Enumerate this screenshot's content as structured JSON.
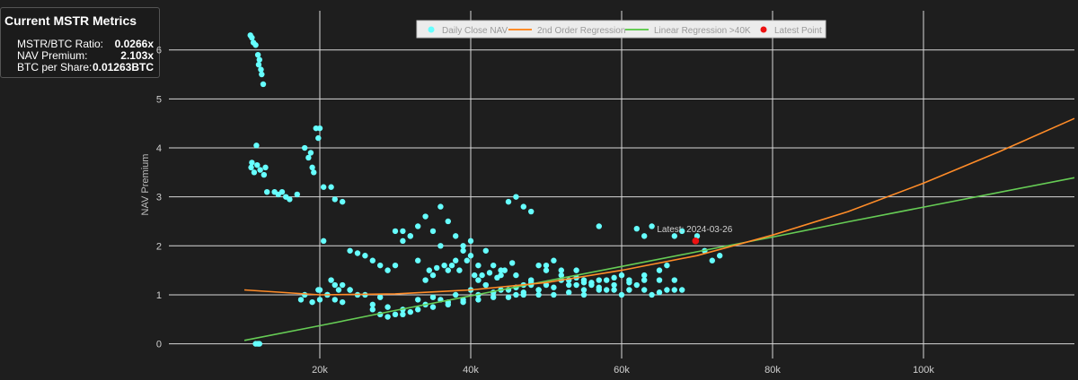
{
  "metrics": {
    "title": "Current MSTR Metrics",
    "rows": [
      {
        "label": "MSTR/BTC Ratio:",
        "value": "0.0266x"
      },
      {
        "label": "NAV Premium:",
        "value": "2.103x"
      },
      {
        "label": "BTC per Share:",
        "value": "0.01263BTC"
      }
    ]
  },
  "chart_data": {
    "type": "scatter",
    "ylabel": "NAV Premium",
    "xlim": [
      0,
      120000
    ],
    "ylim": [
      -0.3,
      6.8
    ],
    "x_ticks": [
      20000,
      40000,
      60000,
      80000,
      100000
    ],
    "x_tick_labels": [
      "20k",
      "40k",
      "60k",
      "80k",
      "100k"
    ],
    "y_ticks": [
      0,
      1,
      2,
      3,
      4,
      5,
      6
    ],
    "y_tick_labels": [
      "0",
      "1",
      "2",
      "3",
      "4",
      "5",
      "6"
    ],
    "grid": true,
    "legend_position": "top-center",
    "latest_annotation": "Latest: 2024-03-26",
    "colors": {
      "points": "#66ffff",
      "quad": "#ff8c28",
      "linear": "#66cc55",
      "latest": "#ee1111",
      "grid": "#d8d8d8"
    },
    "series": [
      {
        "name": "Daily Close NAV",
        "kind": "markers",
        "x": [
          10800,
          11000,
          11200,
          11500,
          11800,
          12000,
          11900,
          12300,
          12500,
          12200,
          11000,
          10900,
          11300,
          11700,
          12100,
          11600,
          12800,
          12600,
          13000,
          14000,
          14500,
          15000,
          15500,
          16000,
          17000,
          18000,
          18500,
          19000,
          19500,
          20000,
          19800,
          18800,
          19200,
          20500,
          21500,
          22000,
          23000,
          24000,
          25000,
          26000,
          27000,
          28000,
          29000,
          30000,
          31000,
          32000,
          33000,
          34000,
          35000,
          36000,
          37000,
          38000,
          39000,
          40000,
          41000,
          42000,
          43000,
          44000,
          45000,
          46000,
          47000,
          48000,
          49000,
          50000,
          51000,
          52000,
          53000,
          54000,
          55000,
          56000,
          57000,
          58000,
          59000,
          60000,
          61000,
          62000,
          63000,
          64000,
          65000,
          66000,
          67000,
          68000,
          17500,
          19000,
          20000,
          21000,
          22000,
          23000,
          25000,
          27000,
          29000,
          31000,
          33000,
          35000,
          37000,
          39000,
          41000,
          43000,
          45000,
          47000,
          49000,
          51000,
          53000,
          55000,
          57000,
          59000,
          61000,
          63000,
          65000,
          67000,
          18000,
          20000,
          22000,
          24000,
          26000,
          28000,
          30000,
          32000,
          34000,
          36000,
          38000,
          40000,
          42000,
          44000,
          46000,
          48000,
          50000,
          52000,
          54000,
          56000,
          58000,
          60000,
          36000,
          38000,
          39000,
          40000,
          37000,
          35000,
          34000,
          33000,
          41000,
          42000,
          44000,
          46000,
          48000,
          50000,
          52000,
          54000,
          30000,
          31000,
          32000,
          20500,
          21500,
          23000,
          24000,
          46000,
          47000,
          48000,
          49000,
          55000,
          57000,
          62000,
          63000,
          64000,
          66000,
          67000,
          68000,
          70000,
          71000,
          72000,
          73000,
          11500,
          11800,
          12000,
          19800,
          21000,
          22500,
          27000,
          28000,
          29000,
          31000,
          33000,
          35000,
          37000,
          39000,
          41000,
          43000,
          45000,
          47000,
          49000,
          51000,
          53000,
          55000,
          57000,
          59000,
          61000,
          63000,
          65000,
          36500,
          37500,
          38500,
          39500,
          40500,
          34500,
          35500,
          45500,
          43500,
          42500,
          41500,
          44500
        ],
        "y": [
          6.3,
          6.25,
          6.15,
          6.1,
          5.9,
          5.8,
          5.7,
          5.5,
          5.3,
          5.6,
          3.7,
          3.6,
          3.5,
          3.65,
          3.55,
          4.05,
          3.6,
          3.45,
          3.1,
          3.1,
          3.05,
          3.1,
          3.0,
          2.95,
          3.05,
          4.0,
          3.8,
          3.6,
          4.4,
          4.4,
          4.2,
          3.9,
          3.5,
          3.2,
          3.2,
          2.95,
          2.9,
          1.9,
          1.85,
          1.8,
          1.7,
          1.6,
          1.5,
          2.3,
          2.1,
          2.2,
          2.4,
          2.6,
          2.3,
          2.8,
          2.5,
          2.2,
          2.0,
          1.8,
          1.6,
          1.9,
          1.6,
          1.4,
          2.9,
          3.0,
          2.8,
          2.7,
          1.6,
          1.5,
          1.7,
          1.5,
          1.3,
          1.2,
          1.3,
          1.2,
          1.1,
          1.1,
          1.1,
          1.0,
          1.1,
          1.2,
          1.1,
          1.0,
          1.05,
          1.1,
          1.1,
          1.1,
          0.9,
          0.85,
          0.9,
          1.0,
          0.9,
          0.85,
          1.0,
          0.8,
          0.75,
          0.7,
          0.7,
          0.75,
          0.8,
          0.85,
          0.9,
          0.95,
          0.95,
          1.0,
          1.0,
          1.0,
          1.05,
          1.1,
          1.15,
          1.2,
          1.25,
          1.3,
          1.3,
          1.3,
          1.0,
          1.1,
          1.2,
          1.1,
          1.0,
          0.95,
          0.6,
          0.65,
          0.8,
          0.9,
          1.0,
          1.1,
          1.2,
          1.1,
          1.15,
          1.2,
          1.2,
          1.3,
          1.35,
          1.25,
          1.3,
          1.4,
          2.0,
          1.7,
          1.9,
          2.1,
          1.5,
          1.4,
          1.3,
          1.7,
          1.3,
          1.2,
          1.5,
          1.4,
          1.3,
          1.6,
          1.4,
          1.5,
          1.6,
          2.3,
          2.2,
          2.1,
          1.3,
          1.2,
          1.1,
          1.0,
          1.2,
          1.25,
          1.1,
          1.0,
          2.4,
          2.35,
          2.2,
          2.4,
          1.6,
          2.2,
          2.3,
          2.2,
          1.9,
          1.7,
          1.8,
          0.0,
          0.0,
          0.0,
          1.1,
          1.0,
          1.1,
          0.7,
          0.6,
          0.55,
          0.6,
          0.9,
          0.95,
          0.85,
          0.9,
          1.0,
          1.05,
          1.1,
          1.05,
          1.1,
          1.15,
          1.2,
          1.25,
          1.3,
          1.35,
          1.3,
          1.4,
          1.5,
          1.6,
          1.6,
          1.5,
          1.7,
          1.4,
          1.5,
          1.55,
          1.65,
          1.35,
          1.45,
          1.4,
          1.5
        ]
      },
      {
        "name": "2nd Order Regression",
        "kind": "line",
        "x": [
          10000,
          20000,
          30000,
          40000,
          50000,
          60000,
          70000,
          80000,
          90000,
          100000,
          110000,
          120000
        ],
        "y": [
          1.1,
          1.0,
          1.02,
          1.1,
          1.25,
          1.5,
          1.8,
          2.22,
          2.7,
          3.28,
          3.92,
          4.6
        ]
      },
      {
        "name": "Linear Regression >40K",
        "kind": "line",
        "x": [
          10000,
          20000,
          30000,
          40000,
          50000,
          60000,
          70000,
          80000,
          90000,
          100000,
          110000,
          120000
        ],
        "y": [
          0.07,
          0.37,
          0.68,
          0.98,
          1.28,
          1.58,
          1.88,
          2.18,
          2.49,
          2.79,
          3.09,
          3.39
        ]
      },
      {
        "name": "Latest Point",
        "kind": "marker",
        "x": [
          69800
        ],
        "y": [
          2.1
        ]
      }
    ]
  }
}
